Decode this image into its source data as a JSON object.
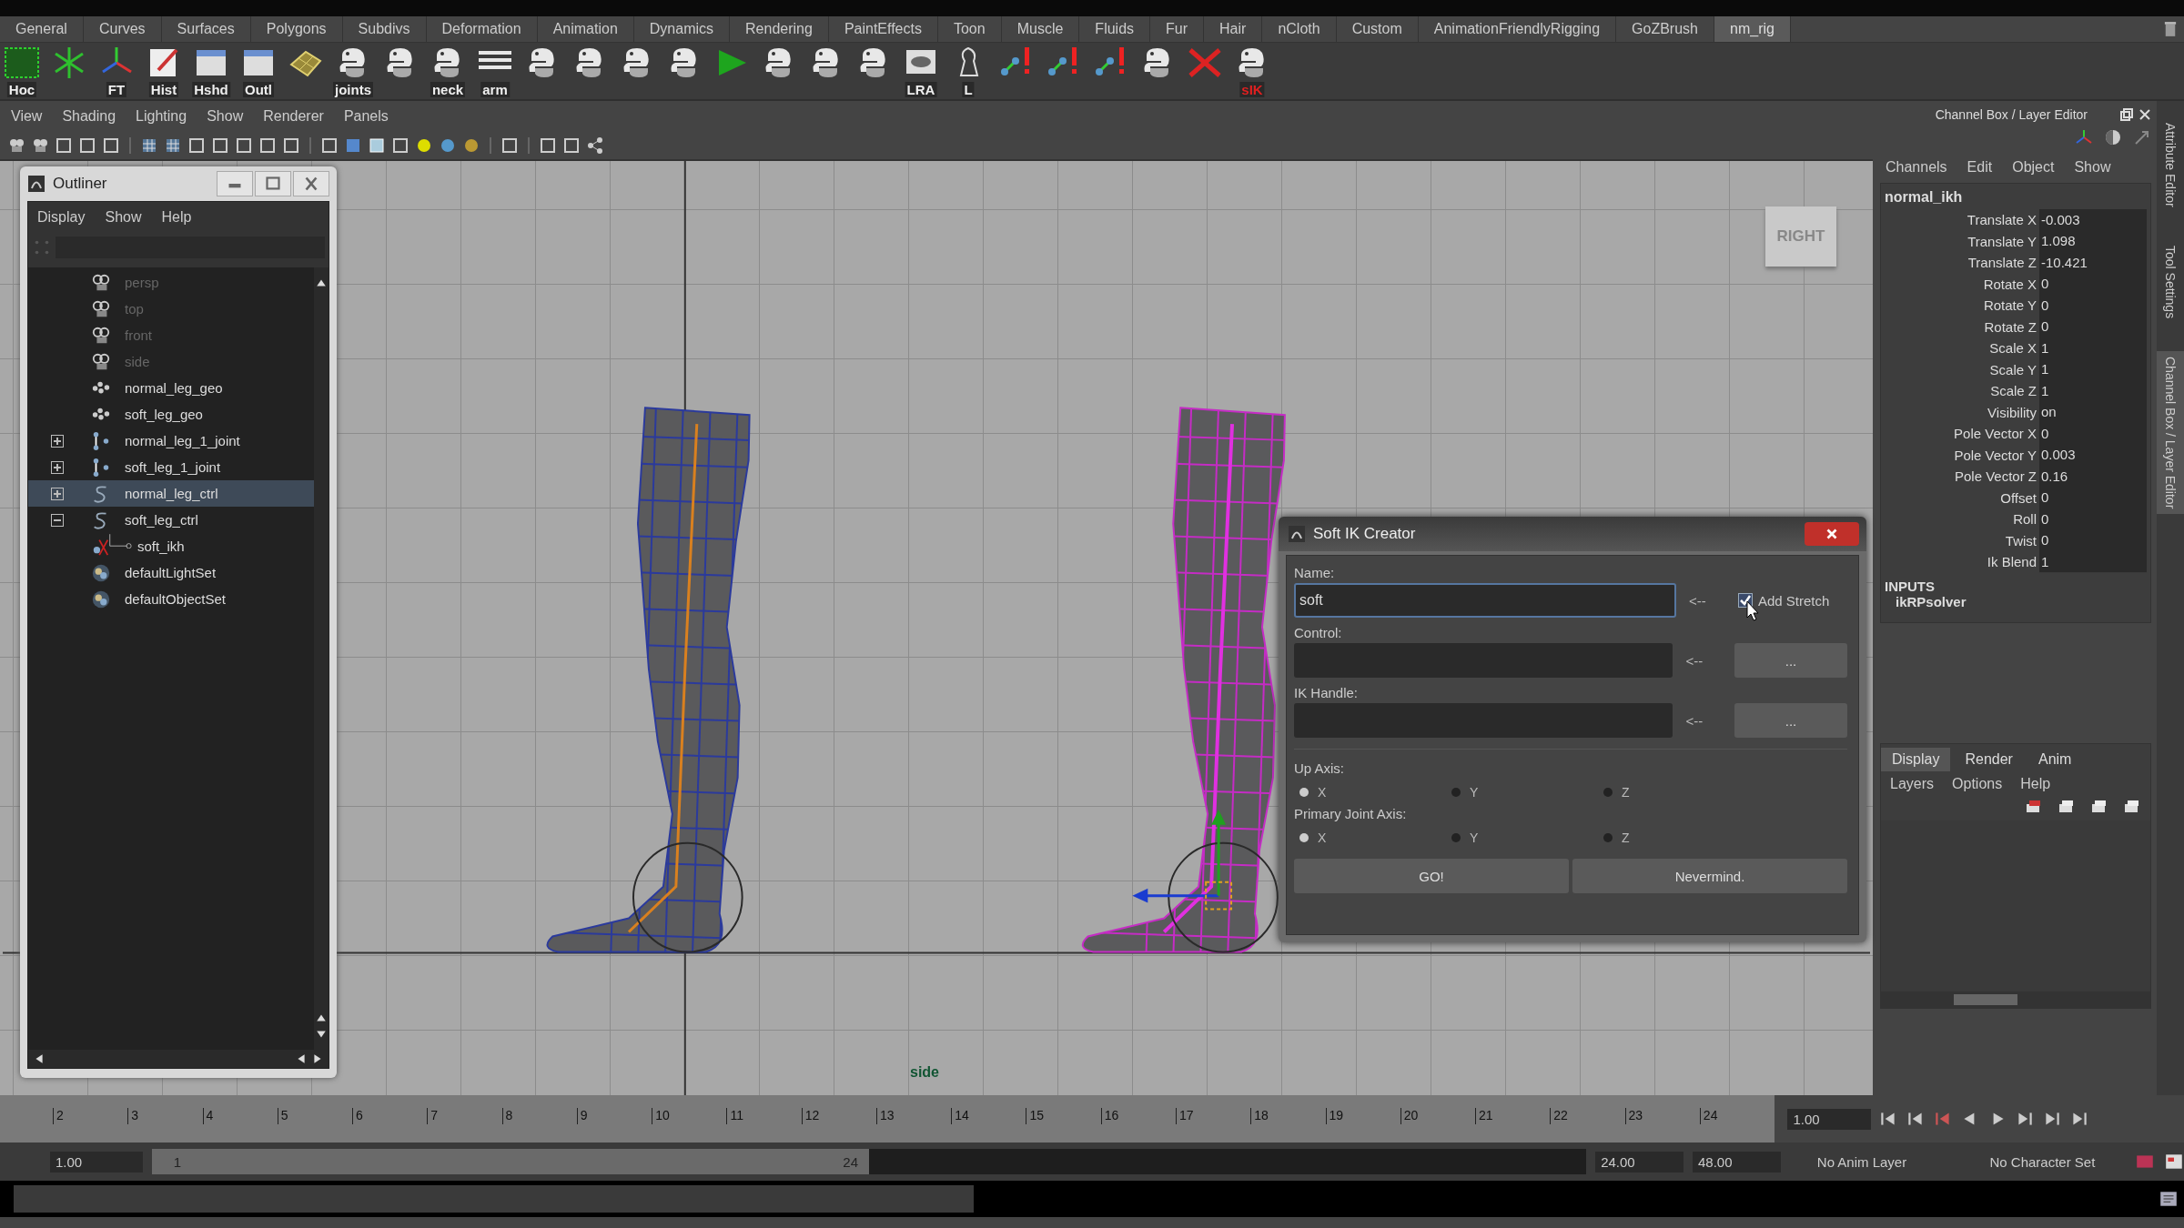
{
  "shelf": {
    "tabs": [
      {
        "label": "General",
        "selected": false
      },
      {
        "label": "Curves",
        "selected": false
      },
      {
        "label": "Surfaces",
        "selected": false
      },
      {
        "label": "Polygons",
        "selected": false
      },
      {
        "label": "Subdivs",
        "selected": false
      },
      {
        "label": "Deformation",
        "selected": false
      },
      {
        "label": "Animation",
        "selected": false
      },
      {
        "label": "Dynamics",
        "selected": false
      },
      {
        "label": "Rendering",
        "selected": false
      },
      {
        "label": "PaintEffects",
        "selected": false
      },
      {
        "label": "Toon",
        "selected": false
      },
      {
        "label": "Muscle",
        "selected": false
      },
      {
        "label": "Fluids",
        "selected": false
      },
      {
        "label": "Fur",
        "selected": false
      },
      {
        "label": "Hair",
        "selected": false
      },
      {
        "label": "nCloth",
        "selected": false
      },
      {
        "label": "Custom",
        "selected": false
      },
      {
        "label": "AnimationFriendlyRigging",
        "selected": false
      },
      {
        "label": "GoZBrush",
        "selected": false
      },
      {
        "label": "nm_rig",
        "selected": true
      }
    ],
    "items": [
      {
        "kind": "box",
        "label": "Hoc"
      },
      {
        "kind": "star"
      },
      {
        "kind": "axes",
        "label": "FT"
      },
      {
        "kind": "doc",
        "label": "Hist"
      },
      {
        "kind": "window",
        "label": "Hshd"
      },
      {
        "kind": "window",
        "label": "Outl"
      },
      {
        "kind": "mesh"
      },
      {
        "kind": "python",
        "label": "joints"
      },
      {
        "kind": "python"
      },
      {
        "kind": "python",
        "label": "neck"
      },
      {
        "kind": "lines",
        "label": "arm"
      },
      {
        "kind": "python"
      },
      {
        "kind": "python"
      },
      {
        "kind": "python"
      },
      {
        "kind": "python"
      },
      {
        "kind": "play"
      },
      {
        "kind": "python"
      },
      {
        "kind": "python"
      },
      {
        "kind": "python"
      },
      {
        "kind": "eye",
        "label": "LRA"
      },
      {
        "kind": "figure",
        "label": "L"
      },
      {
        "kind": "warn"
      },
      {
        "kind": "warn"
      },
      {
        "kind": "warn"
      },
      {
        "kind": "python"
      },
      {
        "kind": "cross"
      },
      {
        "kind": "python_red",
        "label": "sIK"
      }
    ]
  },
  "viewport": {
    "menu": [
      "View",
      "Shading",
      "Lighting",
      "Show",
      "Renderer",
      "Panels"
    ],
    "view_cube": "RIGHT",
    "camera": "side"
  },
  "outliner": {
    "title": "Outliner",
    "menu": [
      "Display",
      "Show",
      "Help"
    ],
    "items": [
      {
        "label": "persp",
        "kind": "camera",
        "hidden": true,
        "selected": false
      },
      {
        "label": "top",
        "kind": "camera",
        "hidden": true,
        "selected": false
      },
      {
        "label": "front",
        "kind": "camera",
        "hidden": true,
        "selected": false
      },
      {
        "label": "side",
        "kind": "camera",
        "hidden": true,
        "selected": false
      },
      {
        "label": "normal_leg_geo",
        "kind": "mesh",
        "hidden": false,
        "selected": false
      },
      {
        "label": "soft_leg_geo",
        "kind": "mesh",
        "hidden": false,
        "selected": false
      },
      {
        "label": "normal_leg_1_joint",
        "kind": "joint",
        "hidden": false,
        "selected": false,
        "expanded": false
      },
      {
        "label": "soft_leg_1_joint",
        "kind": "joint",
        "hidden": false,
        "selected": false,
        "expanded": false
      },
      {
        "label": "normal_leg_ctrl",
        "kind": "curve",
        "hidden": false,
        "selected": true,
        "expanded": false
      },
      {
        "label": "soft_leg_ctrl",
        "kind": "curve",
        "hidden": false,
        "selected": false,
        "expanded": true,
        "children": [
          {
            "label": "soft_ikh",
            "kind": "ik",
            "hidden": false,
            "selected": false
          }
        ]
      },
      {
        "label": "defaultLightSet",
        "kind": "set",
        "hidden": false,
        "selected": false
      },
      {
        "label": "defaultObjectSet",
        "kind": "set",
        "hidden": false,
        "selected": false
      }
    ]
  },
  "channel_box": {
    "title": "Channel Box / Layer Editor",
    "menu": [
      "Channels",
      "Edit",
      "Object",
      "Show"
    ],
    "object": "normal_ikh",
    "attributes": [
      {
        "name": "Translate X",
        "value": "-0.003"
      },
      {
        "name": "Translate Y",
        "value": "1.098"
      },
      {
        "name": "Translate Z",
        "value": "-10.421"
      },
      {
        "name": "Rotate X",
        "value": "0"
      },
      {
        "name": "Rotate Y",
        "value": "0"
      },
      {
        "name": "Rotate Z",
        "value": "0"
      },
      {
        "name": "Scale X",
        "value": "1"
      },
      {
        "name": "Scale Y",
        "value": "1"
      },
      {
        "name": "Scale Z",
        "value": "1"
      },
      {
        "name": "Visibility",
        "value": "on"
      },
      {
        "name": "Pole Vector X",
        "value": "0"
      },
      {
        "name": "Pole Vector Y",
        "value": "0.003"
      },
      {
        "name": "Pole Vector Z",
        "value": "0.16"
      },
      {
        "name": "Offset",
        "value": "0"
      },
      {
        "name": "Roll",
        "value": "0"
      },
      {
        "name": "Twist",
        "value": "0"
      },
      {
        "name": "Ik Blend",
        "value": "1"
      }
    ],
    "inputs_heading": "INPUTS",
    "inputs": [
      "ikRPsolver"
    ]
  },
  "side_tabs": [
    {
      "label": "Attribute Editor",
      "selected": false
    },
    {
      "label": "Tool Settings",
      "selected": false
    },
    {
      "label": "Channel Box / Layer Editor",
      "selected": true
    }
  ],
  "layer_editor": {
    "tabs": [
      {
        "label": "Display",
        "selected": true
      },
      {
        "label": "Render",
        "selected": false
      },
      {
        "label": "Anim",
        "selected": false
      }
    ],
    "menu": [
      "Layers",
      "Options",
      "Help"
    ]
  },
  "dialog": {
    "title": "Soft IK Creator",
    "fields": [
      {
        "label": "Name:",
        "value": "soft",
        "focused": true,
        "arrow": "<--",
        "extra": {
          "kind": "checkbox",
          "label": "Add Stretch",
          "checked": true
        }
      },
      {
        "label": "Control:",
        "focused": false,
        "arrow": "<--",
        "extra": {
          "kind": "button",
          "label": "..."
        }
      },
      {
        "label": "IK Handle:",
        "focused": false,
        "arrow": "<--",
        "extra": {
          "kind": "button",
          "label": "..."
        }
      }
    ],
    "radio_groups": [
      {
        "label": "Up Axis:",
        "options": [
          {
            "label": "X",
            "selected": true
          },
          {
            "label": "Y",
            "selected": false
          },
          {
            "label": "Z",
            "selected": false
          }
        ]
      },
      {
        "label": "Primary Joint Axis:",
        "options": [
          {
            "label": "X",
            "selected": true
          },
          {
            "label": "Y",
            "selected": false
          },
          {
            "label": "Z",
            "selected": false
          }
        ]
      }
    ],
    "buttons": [
      "GO!",
      "Nevermind."
    ]
  },
  "timeline": {
    "frames": [
      "2",
      "3",
      "4",
      "5",
      "6",
      "7",
      "8",
      "9",
      "10",
      "11",
      "12",
      "13",
      "14",
      "15",
      "16",
      "17",
      "18",
      "19",
      "20",
      "21",
      "22",
      "23",
      "24"
    ],
    "current": "1.00"
  },
  "range": {
    "level": 0.5,
    "start": "1.00",
    "slider_start": "1",
    "slider_end": "24",
    "end": "24.00",
    "max": "48.00",
    "anim_layer": "No Anim Layer",
    "character_set": "No Character Set"
  }
}
